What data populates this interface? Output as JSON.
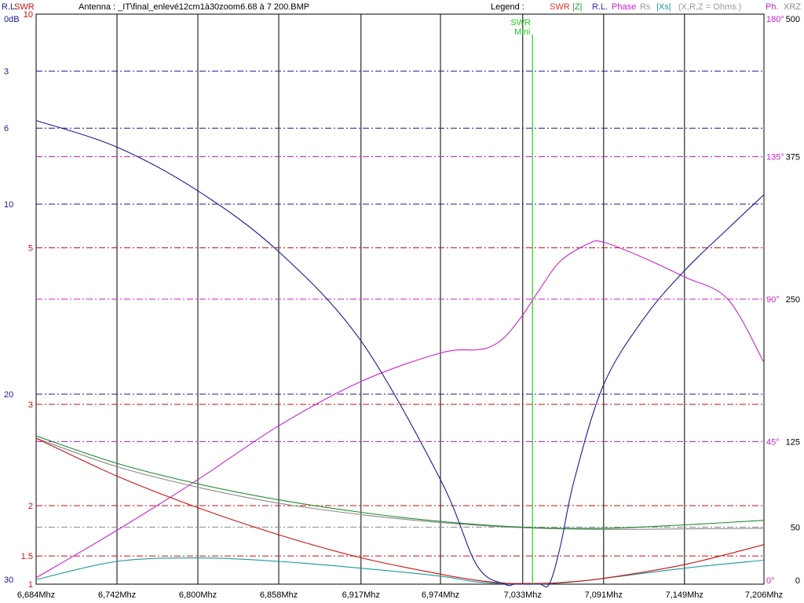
{
  "header": {
    "axis_rl_label": "R.L.",
    "axis_swr_label": "SWR",
    "antenna_text": "Antenna : _IT\\final_enlevé12cm1à30zoom6.68 à 7 200.BMP",
    "legend_label": "Legend :",
    "legend_items": [
      {
        "text": "SWR",
        "color": "#e8312b"
      },
      {
        "text": "|Z|",
        "color": "#1f9e3a"
      },
      {
        "text": "R.L.",
        "color": "#2b2bb8"
      },
      {
        "text": "Phase",
        "color": "#cc22cc"
      },
      {
        "text": "Rs",
        "color": "#9a9a9a"
      },
      {
        "text": "|Xs|",
        "color": "#1a9a9a"
      },
      {
        "text": "(X,R,Z = Ohms.)",
        "color": "#9a9a9a"
      }
    ],
    "ph_label": "Ph.",
    "xrz_label": "XRZ"
  },
  "marker": {
    "line1": "SWR",
    "line2": "Mini",
    "x": 7.04
  },
  "chart_data": {
    "type": "line",
    "xlim": [
      6.684,
      7.206
    ],
    "x_ticks": [
      6.684,
      6.742,
      6.8,
      6.858,
      6.917,
      6.974,
      7.033,
      7.091,
      7.149,
      7.206
    ],
    "x_tick_labels": [
      "6,684Mhz",
      "6,742Mhz",
      "6,800Mhz",
      "6,858Mhz",
      "6,917Mhz",
      "6,974Mhz",
      "7,033Mhz",
      "7,091Mhz",
      "7,149Mhz",
      "7,206Mhz"
    ],
    "swr_axis": {
      "ticks": [
        1,
        1.5,
        2,
        3,
        5,
        10
      ],
      "tick_labels": [
        "1",
        "1.5",
        "2",
        "3",
        "5",
        "10"
      ],
      "color": "#cc1111"
    },
    "rl_axis": {
      "ticks": [
        0,
        3,
        6,
        10,
        20,
        30
      ],
      "tick_labels": [
        "0dB",
        "3",
        "6",
        "10",
        "20",
        "30"
      ],
      "color": "#1a1a99"
    },
    "phase_axis": {
      "ticks": [
        0,
        45,
        90,
        135,
        180
      ],
      "tick_labels": [
        "0°",
        "45°",
        "90°",
        "135°",
        "180°"
      ],
      "color": "#cc22cc"
    },
    "ohm_axis": {
      "ticks": [
        0,
        50,
        125,
        250,
        375,
        500
      ],
      "tick_labels": [
        "0",
        "50",
        "125",
        "250",
        "375",
        "500"
      ]
    },
    "series": [
      {
        "name": "SWR",
        "color": "#cc1111",
        "x": [
          6.684,
          6.742,
          6.8,
          6.858,
          6.917,
          6.974,
          7.0,
          7.02,
          7.033,
          7.045,
          7.06,
          7.091,
          7.149,
          7.206
        ],
        "values": [
          2.65,
          2.28,
          1.98,
          1.72,
          1.48,
          1.27,
          1.16,
          1.08,
          1.06,
          1.07,
          1.1,
          1.2,
          1.4,
          1.62
        ]
      },
      {
        "name": "R.L.",
        "color": "#1a1a99",
        "x": [
          6.684,
          6.742,
          6.8,
          6.858,
          6.917,
          6.974,
          7.0,
          7.02,
          7.027,
          7.033,
          7.045,
          7.052,
          7.06,
          7.07,
          7.091,
          7.12,
          7.149,
          7.18,
          7.206
        ],
        "values": [
          5.6,
          7.0,
          9.3,
          12.5,
          17.2,
          24.5,
          29.0,
          30,
          30,
          30,
          30,
          30,
          28.0,
          24.5,
          19.5,
          16.0,
          13.5,
          11.3,
          9.5
        ]
      },
      {
        "name": "Phase",
        "color": "#cc22cc",
        "x": [
          6.684,
          6.742,
          6.8,
          6.858,
          6.917,
          6.974,
          7.0,
          7.01,
          7.02,
          7.033,
          7.045,
          7.06,
          7.08,
          7.091,
          7.12,
          7.149,
          7.18,
          7.206
        ],
        "values": [
          2,
          17,
          33,
          50,
          64,
          73,
          74,
          75,
          78,
          85,
          93,
          102,
          107.5,
          108,
          103,
          97,
          90,
          70
        ]
      },
      {
        "name": "|Z|",
        "color": "#1f8a2e",
        "x": [
          6.684,
          6.742,
          6.8,
          6.858,
          6.917,
          6.974,
          7.033,
          7.091,
          7.149,
          7.206
        ],
        "values": [
          130,
          106,
          88,
          74,
          63,
          55,
          50,
          49,
          52,
          56
        ]
      },
      {
        "name": "Rs",
        "color": "#8a8a8a",
        "x": [
          6.684,
          6.742,
          6.8,
          6.858,
          6.917,
          6.974,
          7.033,
          7.091,
          7.149,
          7.206
        ],
        "values": [
          128,
          103,
          85,
          71,
          61,
          54,
          49.5,
          48,
          48.5,
          49
        ]
      },
      {
        "name": "|Xs|",
        "color": "#1a9a9a",
        "x": [
          6.684,
          6.742,
          6.8,
          6.858,
          6.917,
          6.974,
          7.0,
          7.033,
          7.06,
          7.091,
          7.149,
          7.206
        ],
        "values": [
          4,
          20,
          23,
          20,
          14,
          7,
          2,
          0,
          1,
          5,
          14,
          21
        ]
      }
    ]
  }
}
